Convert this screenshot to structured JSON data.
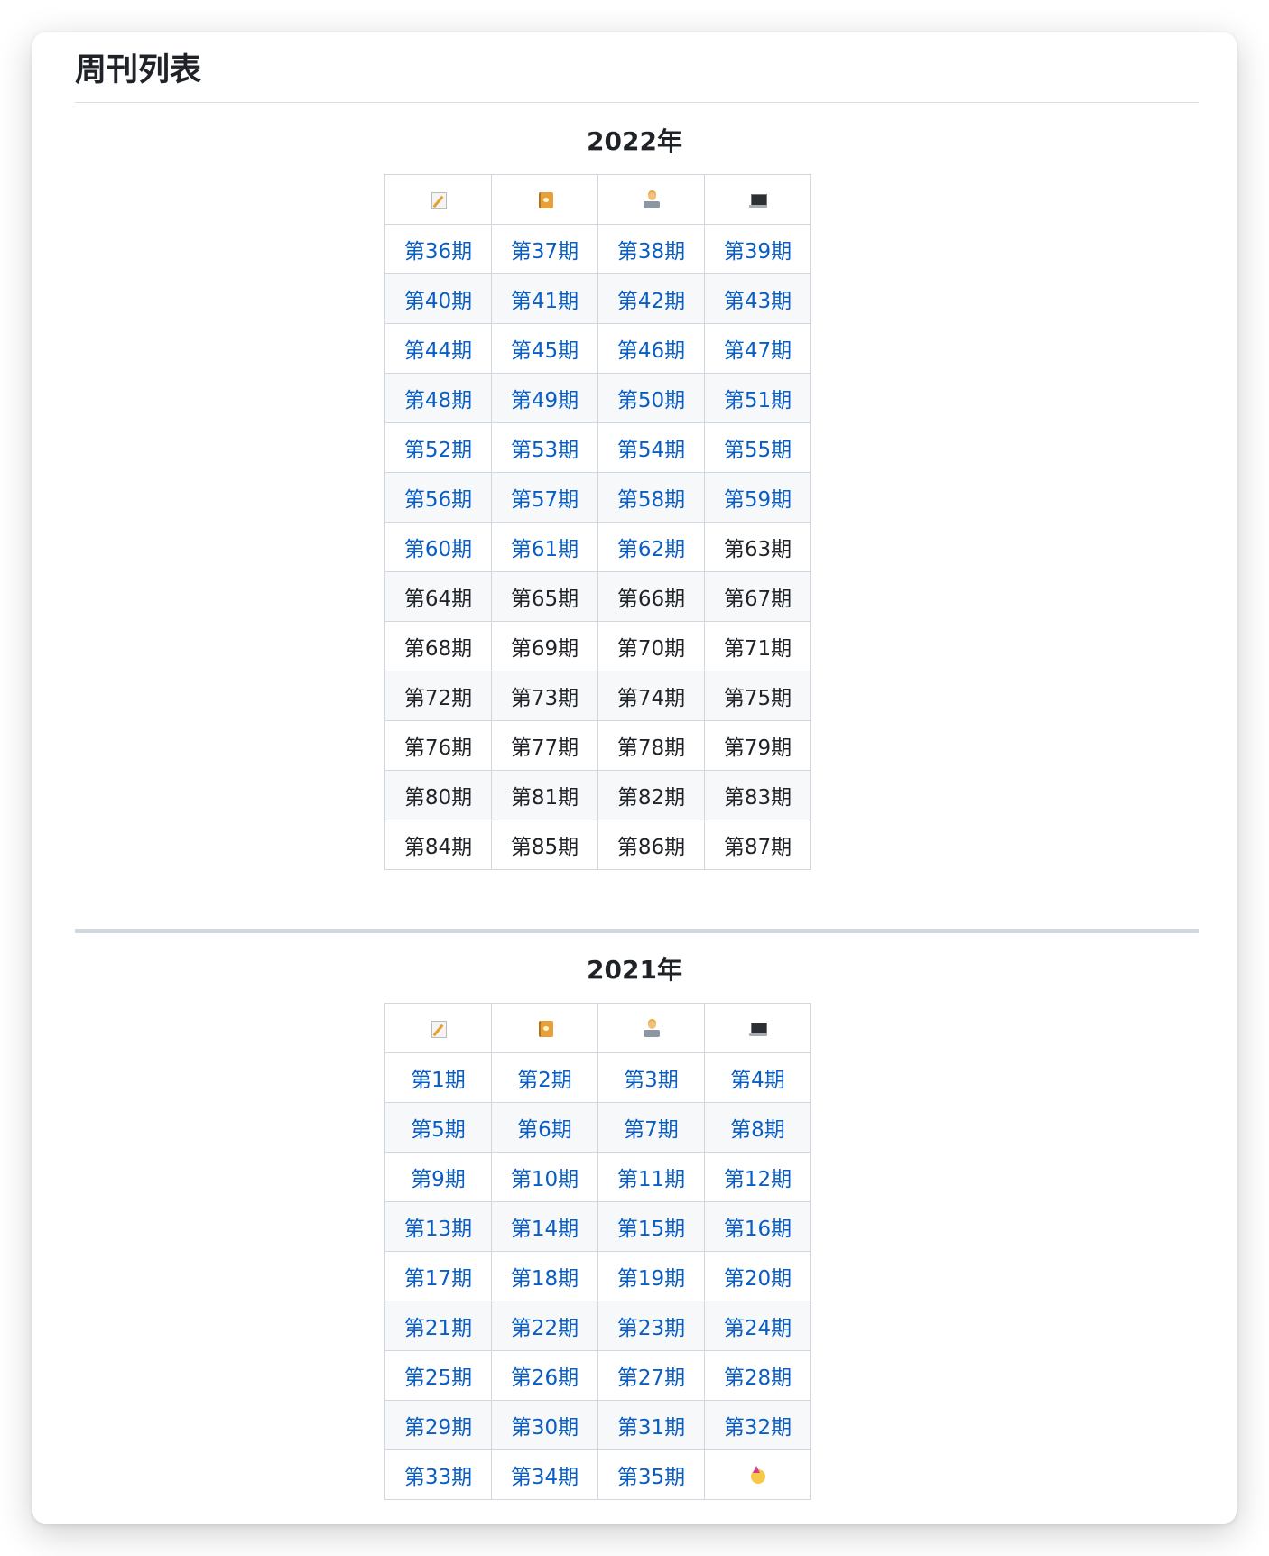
{
  "page_title": "周刊列表",
  "sections": [
    {
      "year": "2022年",
      "icons": [
        "memo-icon",
        "book-icon",
        "technologist-icon",
        "laptop-icon"
      ],
      "rows": [
        [
          "第36期",
          "第37期",
          "第38期",
          "第39期"
        ],
        [
          "第40期",
          "第41期",
          "第42期",
          "第43期"
        ],
        [
          "第44期",
          "第45期",
          "第46期",
          "第47期"
        ],
        [
          "第48期",
          "第49期",
          "第50期",
          "第51期"
        ],
        [
          "第52期",
          "第53期",
          "第54期",
          "第55期"
        ],
        [
          "第56期",
          "第57期",
          "第58期",
          "第59期"
        ],
        [
          "第60期",
          "第61期",
          "第62期",
          "第63期"
        ],
        [
          "第64期",
          "第65期",
          "第66期",
          "第67期"
        ],
        [
          "第68期",
          "第69期",
          "第70期",
          "第71期"
        ],
        [
          "第72期",
          "第73期",
          "第74期",
          "第75期"
        ],
        [
          "第76期",
          "第77期",
          "第78期",
          "第79期"
        ],
        [
          "第80期",
          "第81期",
          "第82期",
          "第83期"
        ],
        [
          "第84期",
          "第85期",
          "第86期",
          "第87期"
        ]
      ],
      "last_linked_issue": "第62期"
    },
    {
      "year": "2021年",
      "icons": [
        "memo-icon",
        "book-icon",
        "technologist-icon",
        "laptop-icon"
      ],
      "rows": [
        [
          "第1期",
          "第2期",
          "第3期",
          "第4期"
        ],
        [
          "第5期",
          "第6期",
          "第7期",
          "第8期"
        ],
        [
          "第9期",
          "第10期",
          "第11期",
          "第12期"
        ],
        [
          "第13期",
          "第14期",
          "第15期",
          "第16期"
        ],
        [
          "第17期",
          "第18期",
          "第19期",
          "第20期"
        ],
        [
          "第21期",
          "第22期",
          "第23期",
          "第24期"
        ],
        [
          "第25期",
          "第26期",
          "第27期",
          "第28期"
        ],
        [
          "第29期",
          "第30期",
          "第31期",
          "第32期"
        ],
        [
          "第33期",
          "第34期",
          "第35期",
          "party-face-icon"
        ]
      ]
    }
  ],
  "colors": {
    "link": "#0a5dc2",
    "text": "#1f2328",
    "border": "#d0d7de",
    "alt_row": "#f6f8fa"
  }
}
